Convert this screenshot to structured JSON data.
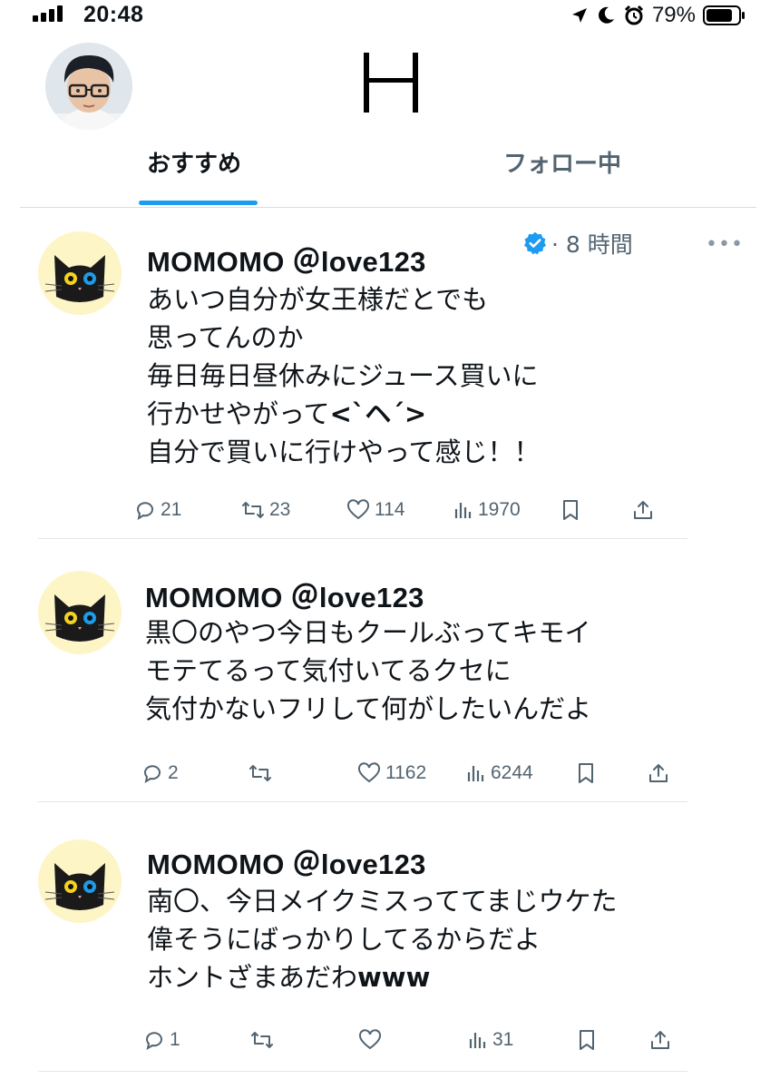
{
  "status_bar": {
    "time": "20:48",
    "battery_percent": "79%"
  },
  "header": {
    "logo_text": "H"
  },
  "tabs": [
    {
      "label": "おすすめ",
      "active": true
    },
    {
      "label": "フォロー中",
      "active": false
    }
  ],
  "posts": [
    {
      "author": "MOMOMO ＠love123",
      "verified": true,
      "time": "· 8 時間",
      "lines": [
        "あいつ自分が女王様だとでも",
        "思ってんのか",
        "毎日毎日昼休みにジュース買いに",
        "行かせやがって",
        "自分で買いに行けやって感じ！！"
      ],
      "emoticon": "<`ヘ´>",
      "stats": {
        "replies": "21",
        "reposts": "23",
        "likes": "114",
        "views": "1970"
      }
    },
    {
      "author": "MOMOMO ＠love123",
      "lines": [
        "黒〇のやつ今日もクールぶってキモイ",
        "モテてるって気付いてるクセに",
        "気付かないフリして何がしたいんだよ"
      ],
      "stats": {
        "replies": "2",
        "reposts": "",
        "likes": "1162",
        "views": "6244"
      }
    },
    {
      "author": "MOMOMO ＠love123",
      "lines": [
        "南〇、今日メイクミスっててまじウケた",
        "偉そうにばっかりしてるからだよ",
        "ホントざまあだわ"
      ],
      "suffix": "www",
      "stats": {
        "replies": "1",
        "reposts": "",
        "likes": "",
        "views": "31"
      }
    }
  ],
  "colors": {
    "accent": "#1d9bf0",
    "muted_text": "#536471",
    "cat_bg": "#fef5c6"
  }
}
